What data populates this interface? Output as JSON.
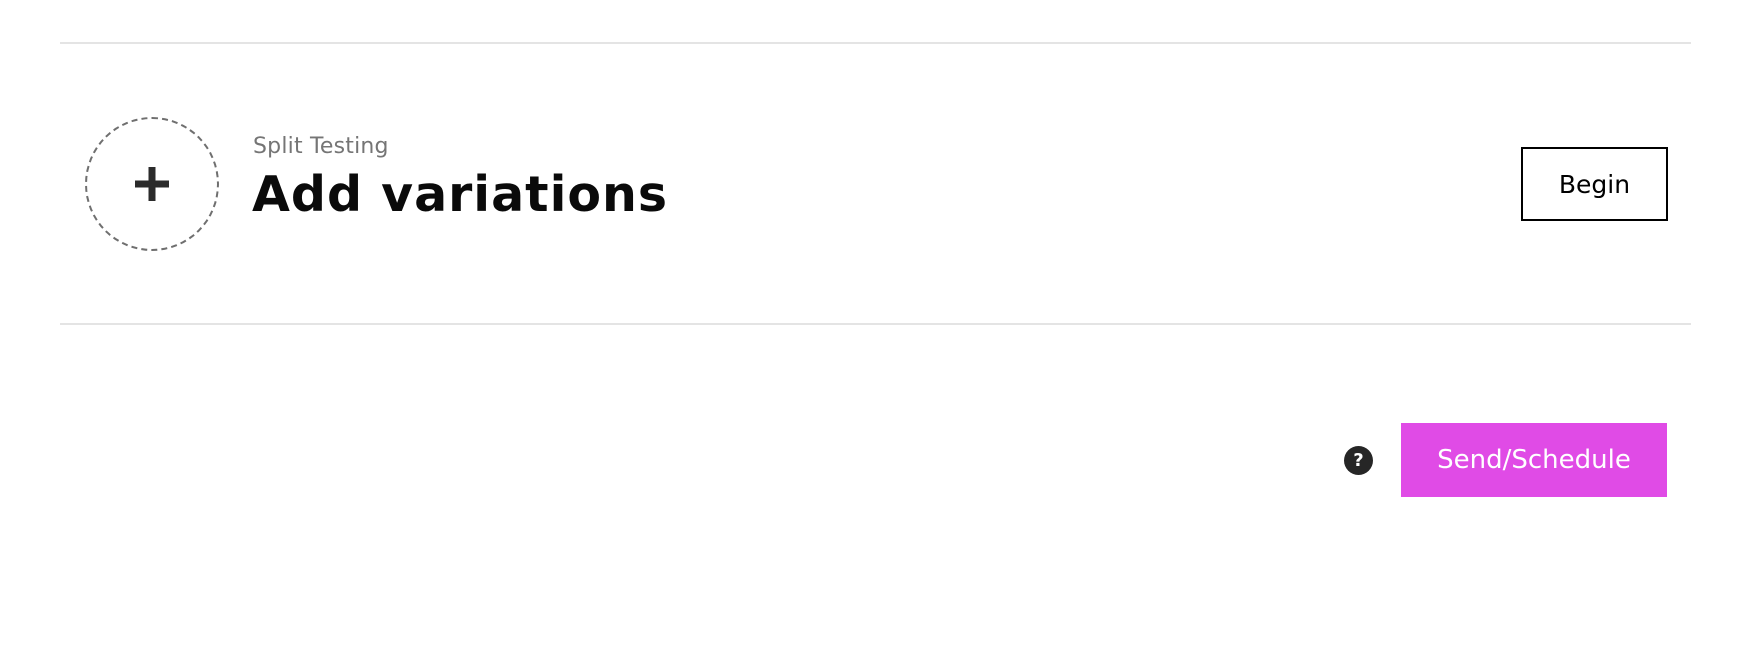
{
  "split_testing": {
    "eyebrow": "Split Testing",
    "title": "Add variations",
    "add_icon": "plus-icon",
    "begin_label": "Begin"
  },
  "footer": {
    "help_icon": "question-circle-icon",
    "help_glyph": "?",
    "send_label": "Send/Schedule"
  },
  "colors": {
    "accent": "#e04be6",
    "divider": "#e4e4e4",
    "muted_text": "#757575",
    "icon_dark": "#262626"
  }
}
